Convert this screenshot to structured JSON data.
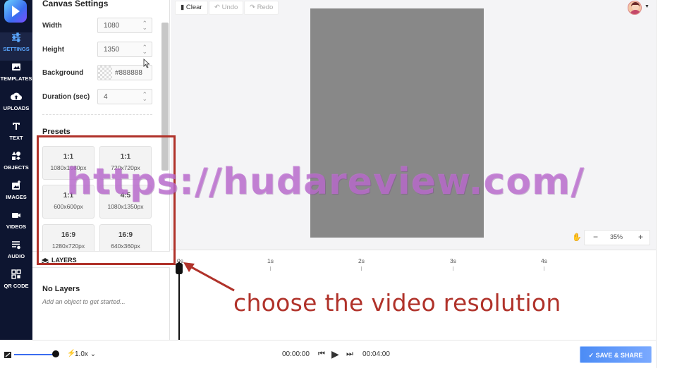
{
  "sidebar": {
    "items": [
      {
        "label": "SETTINGS",
        "icon": "sliders-icon",
        "active": true
      },
      {
        "label": "TEMPLATES",
        "icon": "image-gallery-icon"
      },
      {
        "label": "UPLOADS",
        "icon": "cloud-upload-icon"
      },
      {
        "label": "TEXT",
        "icon": "text-icon"
      },
      {
        "label": "OBJECTS",
        "icon": "shapes-icon"
      },
      {
        "label": "IMAGES",
        "icon": "image-add-icon"
      },
      {
        "label": "VIDEOS",
        "icon": "video-camera-icon"
      },
      {
        "label": "AUDIO",
        "icon": "audio-icon"
      },
      {
        "label": "QR CODE",
        "icon": "qr-code-icon"
      }
    ],
    "accent": "#5aa7ff",
    "background": "#0d1530"
  },
  "panel": {
    "title": "Canvas Settings",
    "width_label": "Width",
    "width_value": "1080",
    "height_label": "Height",
    "height_value": "1350",
    "background_label": "Background",
    "background_value": "#888888",
    "duration_label": "Duration (sec)",
    "duration_value": "4",
    "presets_title": "Presets",
    "presets": [
      {
        "ratio": "1:1",
        "dims": "1080x1080px"
      },
      {
        "ratio": "1:1",
        "dims": "720x720px"
      },
      {
        "ratio": "1:1",
        "dims": "600x600px"
      },
      {
        "ratio": "4:5",
        "dims": "1080x1350px"
      },
      {
        "ratio": "16:9",
        "dims": "1280x720px"
      },
      {
        "ratio": "16:9",
        "dims": "640x360px"
      }
    ]
  },
  "layers": {
    "title": "LAYERS",
    "empty_title": "No Layers",
    "empty_subtitle": "Add an object to get started..."
  },
  "toolbar": {
    "clear_label": "Clear",
    "undo_label": "Undo",
    "redo_label": "Redo"
  },
  "canvas": {
    "color": "#888888"
  },
  "zoom": {
    "minus": "−",
    "value": "35%",
    "plus": "+"
  },
  "timeline": {
    "ticks": [
      "0s",
      "1s",
      "2s",
      "3s",
      "4s"
    ]
  },
  "playback": {
    "speed": "1.0x",
    "current_time": "00:00:00",
    "total_time": "00:04:00"
  },
  "save_button": "SAVE & SHARE",
  "overlay": {
    "watermark": "https://hudareview.com/",
    "annotation": "choose the video resolution",
    "annotation_color": "#b0322a"
  }
}
